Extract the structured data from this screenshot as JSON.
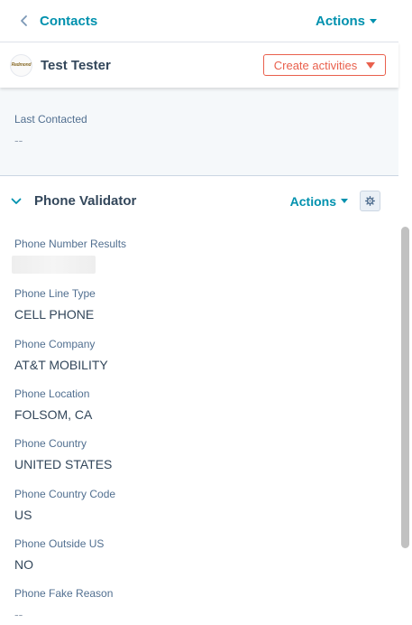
{
  "header": {
    "back_label": "Contacts",
    "actions_label": "Actions"
  },
  "contact": {
    "avatar_text": "Redmond",
    "name": "Test Tester",
    "create_activities_label": "Create activities"
  },
  "last_contacted": {
    "label": "Last Contacted",
    "value": "--"
  },
  "phone_validator": {
    "title": "Phone Validator",
    "actions_label": "Actions",
    "properties": [
      {
        "label": "Phone Number Results",
        "value": ""
      },
      {
        "label": "Phone Line Type",
        "value": "CELL PHONE"
      },
      {
        "label": "Phone Company",
        "value": "AT&T MOBILITY"
      },
      {
        "label": "Phone Location",
        "value": "FOLSOM, CA"
      },
      {
        "label": "Phone Country",
        "value": "UNITED STATES"
      },
      {
        "label": "Phone Country Code",
        "value": "US"
      },
      {
        "label": "Phone Outside US",
        "value": "NO"
      },
      {
        "label": "Phone Fake Reason",
        "value": "--"
      }
    ]
  },
  "colors": {
    "link": "#0091ae",
    "accent": "#e9604d",
    "text": "#33475b"
  }
}
